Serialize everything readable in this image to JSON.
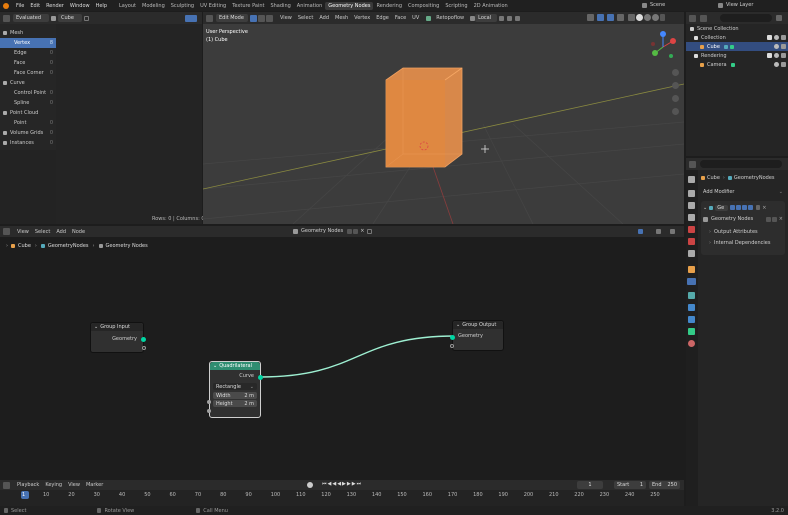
{
  "menu": [
    "File",
    "Edit",
    "Render",
    "Window",
    "Help"
  ],
  "workspaces": [
    "Layout",
    "Modeling",
    "Sculpting",
    "UV Editing",
    "Texture Paint",
    "Shading",
    "Animation",
    "Geometry Nodes",
    "Rendering",
    "Compositing",
    "Scripting",
    "2D Animation"
  ],
  "active_workspace": "Geometry Nodes",
  "scene": "Scene",
  "view_layer": "View Layer",
  "spreadsheet": {
    "mode": "Evaluated",
    "object": "Cube",
    "tree": [
      {
        "label": "Mesh",
        "count": "",
        "level": 0
      },
      {
        "label": "Vertex",
        "count": "8",
        "level": 1,
        "active": true
      },
      {
        "label": "Edge",
        "count": "0",
        "level": 1
      },
      {
        "label": "Face",
        "count": "0",
        "level": 1
      },
      {
        "label": "Face Corner",
        "count": "0",
        "level": 1
      },
      {
        "label": "Curve",
        "count": "",
        "level": 0
      },
      {
        "label": "Control Point",
        "count": "0",
        "level": 1
      },
      {
        "label": "Spline",
        "count": "0",
        "level": 1
      },
      {
        "label": "Point Cloud",
        "count": "",
        "level": 0
      },
      {
        "label": "Point",
        "count": "0",
        "level": 1
      },
      {
        "label": "Volume Grids",
        "count": "0",
        "level": 0
      },
      {
        "label": "Instances",
        "count": "0",
        "level": 0
      }
    ],
    "status": "Rows: 0  |  Columns: 0"
  },
  "viewport": {
    "mode": "Edit Mode",
    "menus": [
      "View",
      "Select",
      "Add",
      "Mesh",
      "Vertex",
      "Edge",
      "Face",
      "UV"
    ],
    "snap": "Retopoflow",
    "orientation": "Local",
    "perspective": "User Perspective",
    "object": "(1) Cube"
  },
  "outliner": {
    "search_placeholder": "",
    "items": [
      {
        "label": "Scene Collection",
        "level": 0
      },
      {
        "label": "Collection",
        "level": 1
      },
      {
        "label": "Cube",
        "level": 2,
        "selected": true
      },
      {
        "label": "Rendering",
        "level": 1
      },
      {
        "label": "Camera",
        "level": 2
      }
    ]
  },
  "properties": {
    "breadcrumb_obj": "Cube",
    "breadcrumb_mod": "GeometryNodes",
    "add_modifier": "Add Modifier",
    "modifier_name": "Ge",
    "node_group": "Geometry Nodes",
    "sections": [
      "Output Attributes",
      "Internal Dependencies"
    ]
  },
  "node_editor": {
    "menus": [
      "View",
      "Select",
      "Add",
      "Node"
    ],
    "tree_name": "Geometry Nodes",
    "breadcrumb": [
      "Cube",
      "GeometryNodes",
      "Geometry Nodes"
    ],
    "group_input": {
      "title": "Group Input",
      "output": "Geometry"
    },
    "group_output": {
      "title": "Group Output",
      "input": "Geometry"
    },
    "quad": {
      "title": "Quadrilateral",
      "output": "Curve",
      "mode": "Rectangle",
      "width_label": "Width",
      "width_value": "2 m",
      "height_label": "Height",
      "height_value": "2 m"
    }
  },
  "timeline": {
    "menus": [
      "Playback",
      "Keying",
      "View",
      "Marker"
    ],
    "current_frame": "1",
    "start_label": "Start",
    "start": "1",
    "end_label": "End",
    "end": "250",
    "ticks": [
      "1",
      "10",
      "20",
      "30",
      "40",
      "50",
      "60",
      "70",
      "80",
      "90",
      "100",
      "110",
      "120",
      "130",
      "140",
      "150",
      "160",
      "170",
      "180",
      "190",
      "200",
      "210",
      "220",
      "230",
      "240",
      "250"
    ]
  },
  "status_bar": {
    "select": "Select",
    "rotate": "Rotate View",
    "menu": "Call Menu",
    "version": "3.2.0"
  },
  "colors": {
    "accent": "#4772b3",
    "node_green": "#2f8d71",
    "socket_green": "#00d6a3",
    "socket_gray": "#a1a1a1",
    "cube": "#e0823f",
    "link": "#9ef0d2"
  }
}
